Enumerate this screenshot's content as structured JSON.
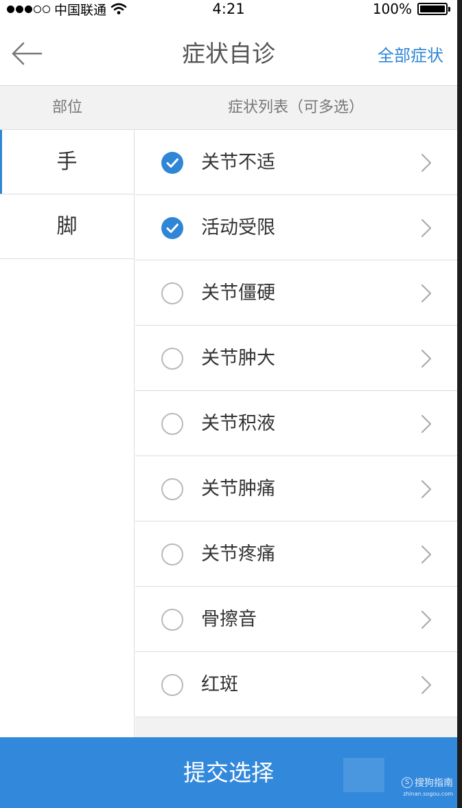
{
  "status_bar": {
    "carrier": "中国联通",
    "time": "4:21",
    "battery": "100%",
    "signal_dots_filled": 3,
    "signal_dots_total": 5,
    "battery_level": 1.0
  },
  "nav": {
    "back_icon": "arrow-left-icon",
    "title": "症状自诊",
    "action_label": "全部症状"
  },
  "header": {
    "left_label": "部位",
    "right_label": "症状列表（可多选）"
  },
  "body_parts": [
    {
      "label": "手",
      "active": true
    },
    {
      "label": "脚",
      "active": false
    }
  ],
  "symptoms": [
    {
      "label": "关节不适",
      "checked": true
    },
    {
      "label": "活动受限",
      "checked": true
    },
    {
      "label": "关节僵硬",
      "checked": false
    },
    {
      "label": "关节肿大",
      "checked": false
    },
    {
      "label": "关节积液",
      "checked": false
    },
    {
      "label": "关节肿痛",
      "checked": false
    },
    {
      "label": "关节疼痛",
      "checked": false
    },
    {
      "label": "骨擦音",
      "checked": false
    },
    {
      "label": "红斑",
      "checked": false
    }
  ],
  "submit_label": "提交选择",
  "watermark": {
    "brand": "搜狗指南",
    "logo_letter": "S",
    "url": "zhinan.sogou.com"
  },
  "colors": {
    "accent": "#2f86d6",
    "submit_bar": "#3288db",
    "header_bg": "#f2f2f2",
    "divider": "#dcdcdc"
  }
}
